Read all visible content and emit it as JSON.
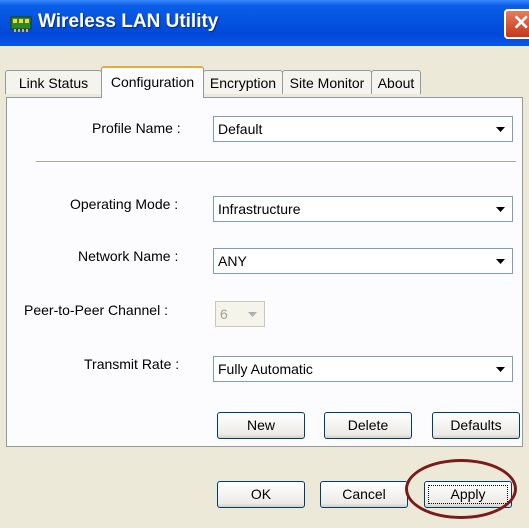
{
  "window": {
    "title": "Wireless LAN Utility",
    "close_glyph": "×"
  },
  "tabs": [
    {
      "label": "Link Status",
      "active": false
    },
    {
      "label": "Configuration",
      "active": true
    },
    {
      "label": "Encryption",
      "active": false
    },
    {
      "label": "Site Monitor",
      "active": false
    },
    {
      "label": "About",
      "active": false
    }
  ],
  "form": {
    "profile_name": {
      "label": "Profile Name :",
      "value": "Default"
    },
    "operating_mode": {
      "label": "Operating Mode :",
      "value": "Infrastructure"
    },
    "network_name": {
      "label": "Network Name :",
      "value": "ANY"
    },
    "peer_channel": {
      "label": "Peer-to-Peer Channel :",
      "value": "6"
    },
    "transmit_rate": {
      "label": "Transmit Rate :",
      "value": "Fully Automatic"
    }
  },
  "profile_buttons": {
    "new": "New",
    "delete": "Delete",
    "defaults": "Defaults"
  },
  "dialog_buttons": {
    "ok": "OK",
    "cancel": "Cancel",
    "apply": "Apply"
  },
  "colors": {
    "title_bar": "#0553e0",
    "highlight_ellipse": "#7a1a1a",
    "dialog_bg": "#ece9d8",
    "tab_highlight": "#e6a93b"
  },
  "icons": {
    "title": "network-card-icon",
    "dropdown": "chevron-down-icon",
    "close": "close-icon"
  }
}
